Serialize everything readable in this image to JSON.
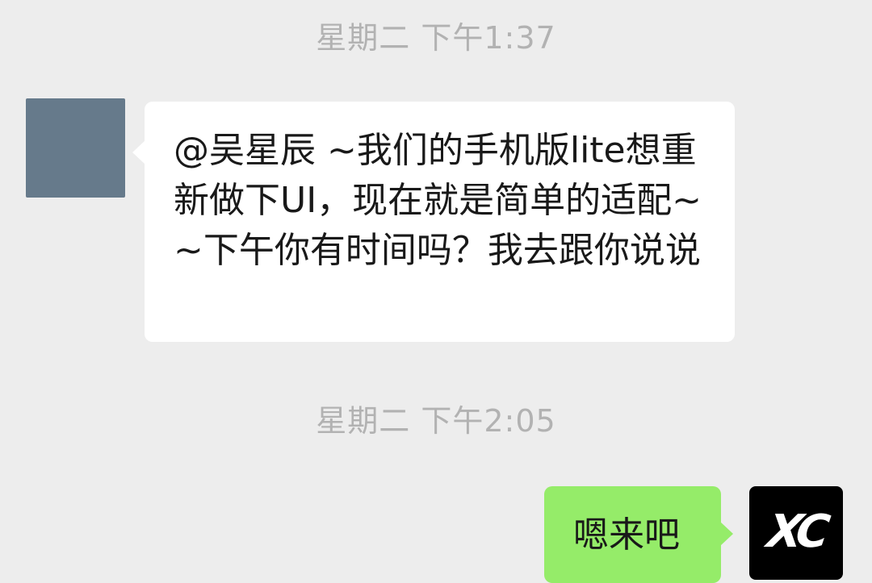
{
  "messages": [
    {
      "timestamp": "星期二 下午1:37",
      "sender": "left",
      "text": "@吴星辰 ~我们的手机版lite想重新做下UI，现在就是简单的适配~~下午你有时间吗？我去跟你说说"
    },
    {
      "timestamp": "星期二 下午2:05",
      "sender": "right",
      "text": "嗯来吧",
      "avatar_text": "XC"
    }
  ],
  "colors": {
    "background": "#ededed",
    "incoming_bubble": "#ffffff",
    "outgoing_bubble": "#95ec69",
    "timestamp_text": "#b2b2b2"
  }
}
